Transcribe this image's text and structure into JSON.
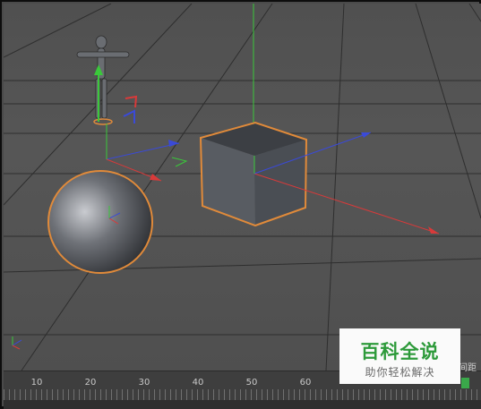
{
  "viewport": {
    "objects": [
      "figure",
      "sphere",
      "cube"
    ],
    "colors": {
      "selection_outline": "#e08a3a",
      "axis_x": "#d83a3a",
      "axis_y": "#3ac83a",
      "axis_z": "#3a4ad8",
      "grid": "#2e2e2e"
    },
    "icons": [
      "world-axis-icon",
      "move-gizmo-icon"
    ]
  },
  "timeline": {
    "ticks": [
      "10",
      "20",
      "30",
      "40",
      "50",
      "60"
    ]
  },
  "side_label": "间距",
  "watermark": {
    "title": "百科全说",
    "subtitle": "助你轻松解决"
  }
}
